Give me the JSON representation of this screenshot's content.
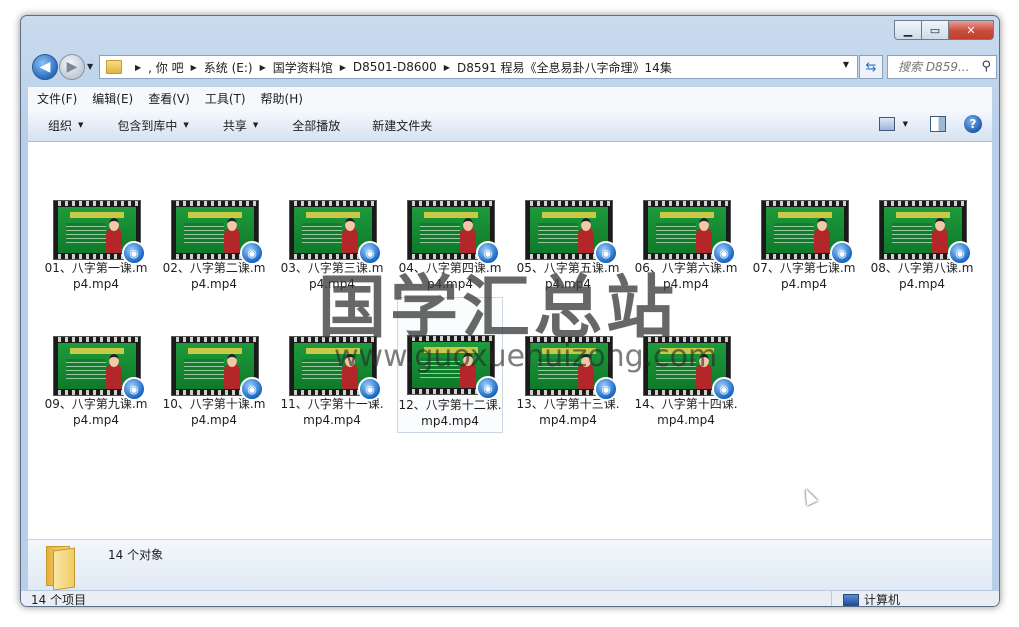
{
  "window": {
    "min_icon": "minimize-icon",
    "max_icon": "maximize-icon",
    "close_icon": "close-icon"
  },
  "nav": {
    "breadcrumb": [
      ", 你   吧",
      "系统 (E:)",
      "国学资料馆",
      "D8501-D8600",
      "D8591 程易《全息易卦八字命理》14集"
    ],
    "search_placeholder": "搜索 D859..."
  },
  "menu": [
    "文件(F)",
    "编辑(E)",
    "查看(V)",
    "工具(T)",
    "帮助(H)"
  ],
  "toolbar": {
    "organize": "组织",
    "include_library": "包含到库中",
    "share": "共享",
    "play_all": "全部播放",
    "new_folder": "新建文件夹"
  },
  "files": [
    {
      "name": "01、八字第一课.mp4.mp4"
    },
    {
      "name": "02、八字第二课.mp4.mp4"
    },
    {
      "name": "03、八字第三课.mp4.mp4"
    },
    {
      "name": "04、八字第四课.mp4.mp4"
    },
    {
      "name": "05、八字第五课.mp4.mp4"
    },
    {
      "name": "06、八字第六课.mp4.mp4"
    },
    {
      "name": "07、八字第七课.mp4.mp4"
    },
    {
      "name": "08、八字第八课.mp4.mp4"
    },
    {
      "name": "09、八字第九课.mp4.mp4"
    },
    {
      "name": "10、八字第十课.mp4.mp4"
    },
    {
      "name": "11、八字第十一课.mp4.mp4"
    },
    {
      "name": "12、八字第十二课.mp4.mp4"
    },
    {
      "name": "13、八字第十三课.mp4.mp4"
    },
    {
      "name": "14、八字第十四课.mp4.mp4"
    }
  ],
  "watermark": {
    "text": "国学汇总站",
    "url": "www.guoxuehuizong.com"
  },
  "details": {
    "count": "14 个对象"
  },
  "status": {
    "items": "14 个项目",
    "location": "计算机"
  }
}
